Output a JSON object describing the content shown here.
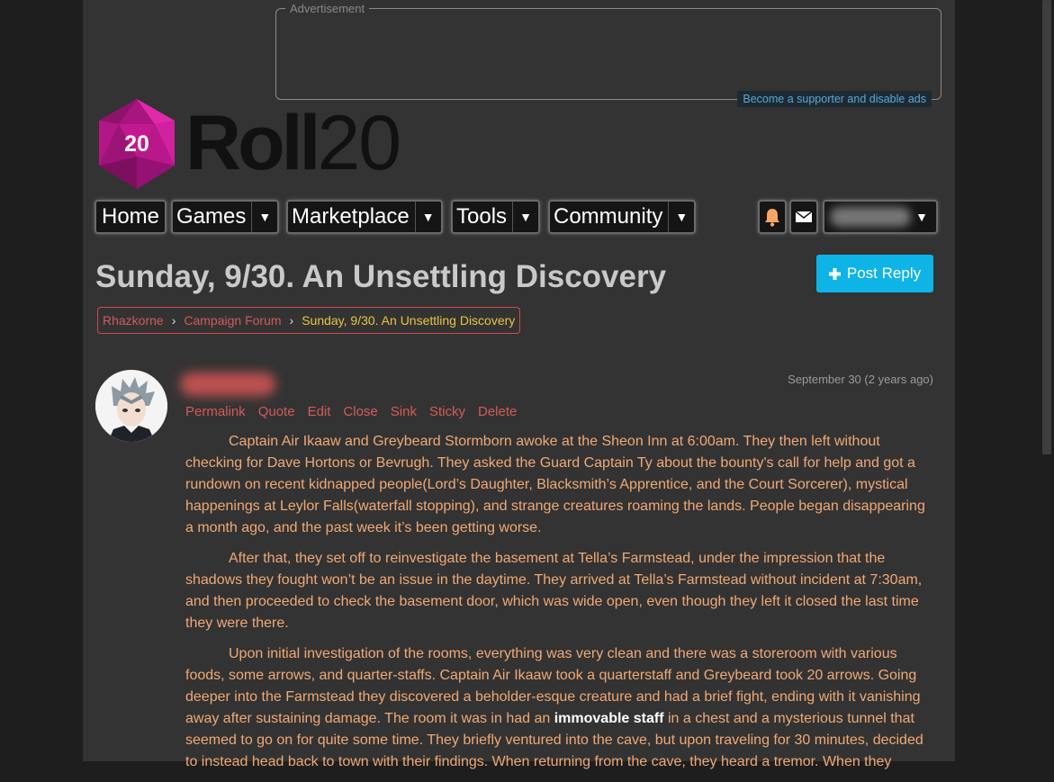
{
  "ad": {
    "legend": "Advertisement",
    "support_link": "Become a supporter and disable ads"
  },
  "logo": {
    "die_number": "20",
    "wordmark_bold": "Roll",
    "wordmark_thin": "20",
    "die_color": "#c31990"
  },
  "nav": {
    "home": "Home",
    "games": "Games",
    "marketplace": "Marketplace",
    "tools": "Tools",
    "community": "Community",
    "caret": "▼"
  },
  "thread": {
    "title": "Sunday, 9/30. An Unsettling Discovery",
    "post_reply": "Post Reply"
  },
  "breadcrumb": {
    "items": [
      "Rhazkorne",
      "Campaign Forum",
      "Sunday, 9/30. An Unsettling Discovery"
    ],
    "sep": "›"
  },
  "post": {
    "date": "September 30 (2 years ago)",
    "actions": [
      "Permalink",
      "Quote",
      "Edit",
      "Close",
      "Sink",
      "Sticky",
      "Delete"
    ],
    "paragraphs": [
      "Captain Air Ikaaw and Greybeard Stormborn awoke at the Sheon Inn at 6:00am. They then left without checking for Dave Hortons or Bevrugh. They asked the Guard Captain Ty about the bounty's call for help and got a rundown on recent kidnapped people(Lord’s Daughter, Blacksmith’s Apprentice, and the Court Sorcerer), mystical happenings at Leylor Falls(waterfall stopping), and strange creatures roaming the lands. People began disappearing a month ago, and the past week it’s been getting worse.",
      "After that, they set off to reinvestigate the basement at Tella’s Farmstead, under the impression that the shadows they fought won’t be an issue in the daytime. They arrived at Tella’s Farmstead without incident at 7:30am, and then proceeded to check the basement door, which was wide open, even though they left it closed the last time they were there."
    ],
    "p3_before": "Upon initial investigation of the rooms, everything was very clean and there was a storeroom with various foods, some arrows, and quarter-staffs. Captain Air Ikaaw took a quarterstaff and Greybeard took 20 arrows. Going deeper into the Farmstead they discovered a beholder-esque creature and had a brief fight, ending with it vanishing away after sustaining damage. The room it was in had an ",
    "p3_bold": "immovable staff",
    "p3_after": " in a chest and a mysterious tunnel that seemed to go on for quite some time. They briefly ventured into the cave, but upon traveling for 30 minutes, decided to instead head back to town with their findings. When returning from the cave, they heard a tremor. When they"
  },
  "colors": {
    "background": "#1e1e1e",
    "page": "#333333",
    "accent": "#0fb4e6",
    "link": "#d35a5a",
    "current_crumb": "#e8c441",
    "body_text": "#f0a976"
  }
}
